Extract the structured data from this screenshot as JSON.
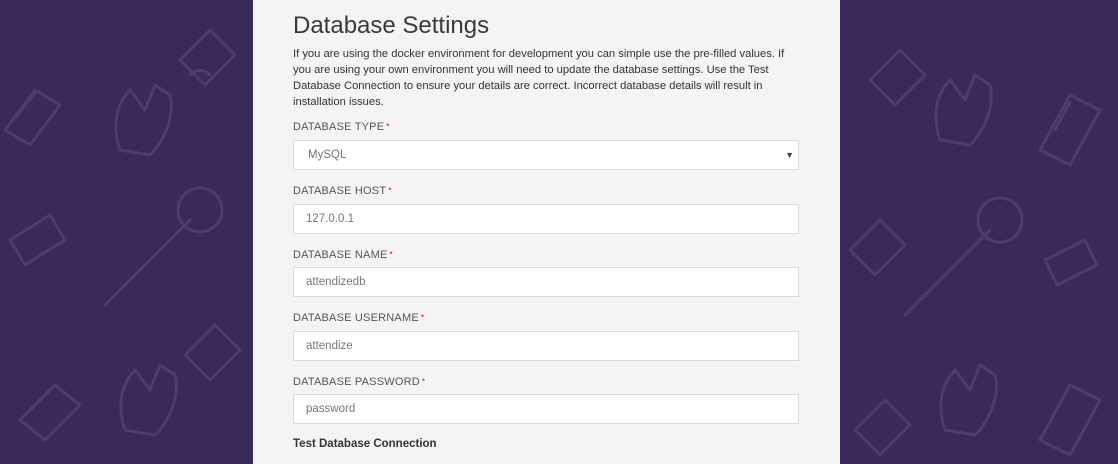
{
  "page": {
    "title": "Database Settings",
    "intro": "If you are using the docker environment for development you can simple use the pre-filled values. If you are using your own environment you will need to update the database settings. Use the Test Database Connection to ensure your details are correct. Incorrect database details will result in installation issues."
  },
  "fields": {
    "type": {
      "label": "DATABASE TYPE",
      "value": "MySQL"
    },
    "host": {
      "label": "DATABASE HOST",
      "value": "127.0.0.1"
    },
    "name": {
      "label": "DATABASE NAME",
      "value": "attendizedb"
    },
    "username": {
      "label": "DATABASE USERNAME",
      "value": "attendize"
    },
    "password": {
      "label": "DATABASE PASSWORD",
      "value": "password"
    }
  },
  "required_marker": "•",
  "select_caret": "▼",
  "test_connection": {
    "heading": "Test Database Connection"
  },
  "colors": {
    "background": "#3a2a5c",
    "panel": "#f4f4f6",
    "required": "#d9534f"
  }
}
